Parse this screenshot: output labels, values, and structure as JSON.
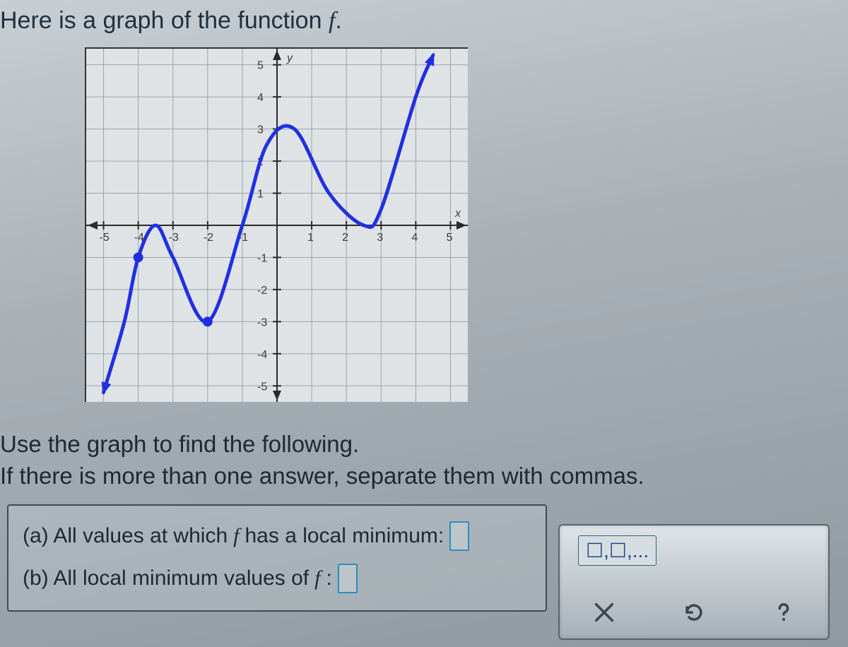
{
  "intro_prefix": "Here is a graph of the function ",
  "intro_var": "f",
  "intro_suffix": ".",
  "instructions_line1": "Use the graph to find the following.",
  "instructions_line2": "If there is more than one answer, separate them with commas.",
  "questions": {
    "a_prefix": "(a) All values at which ",
    "a_var": "f",
    "a_suffix": " has a local minimum:",
    "b_prefix": "(b) All local minimum values of ",
    "b_var": "f",
    "b_suffix": ":"
  },
  "toolbox": {
    "list_button_label": "☐,☐,...",
    "clear_label": "Clear",
    "reset_label": "Reset",
    "help_label": "Help"
  },
  "chart_data": {
    "type": "line",
    "title": "",
    "xlabel": "x",
    "ylabel": "y",
    "xlim": [
      -5.5,
      5.5
    ],
    "ylim": [
      -5.5,
      5.5
    ],
    "x_ticks": [
      -5,
      -4,
      -3,
      -2,
      -1,
      1,
      2,
      3,
      4,
      5
    ],
    "y_ticks": [
      -5,
      -4,
      -3,
      -2,
      -1,
      1,
      2,
      3,
      4,
      5
    ],
    "grid": true,
    "series": [
      {
        "name": "f",
        "closed_endpoints": [
          {
            "x": -4,
            "y": -1
          },
          {
            "x": -2,
            "y": -3
          }
        ],
        "points": [
          {
            "x": -5,
            "y": -5.2,
            "arrow": true
          },
          {
            "x": -4.4,
            "y": -3.0
          },
          {
            "x": -4,
            "y": -1,
            "closed_dot": true
          },
          {
            "x": -3.5,
            "y": 0
          },
          {
            "x": -3,
            "y": -1
          },
          {
            "x": -2,
            "y": -3,
            "closed_dot": true
          },
          {
            "x": -1,
            "y": 0
          },
          {
            "x": -0.3,
            "y": 2.5
          },
          {
            "x": 0.5,
            "y": 3,
            "local_max": true
          },
          {
            "x": 1.5,
            "y": 1
          },
          {
            "x": 2.5,
            "y": 0,
            "local_min": true
          },
          {
            "x": 3,
            "y": 0.5
          },
          {
            "x": 4,
            "y": 4
          },
          {
            "x": 4.5,
            "y": 5.3,
            "arrow": true
          }
        ],
        "local_minimum_x_values_answer": [
          -2,
          2.5
        ],
        "local_minimum_y_values_answer": [
          -3,
          0
        ]
      }
    ],
    "axis_label_x": "x",
    "axis_label_y": "y"
  }
}
